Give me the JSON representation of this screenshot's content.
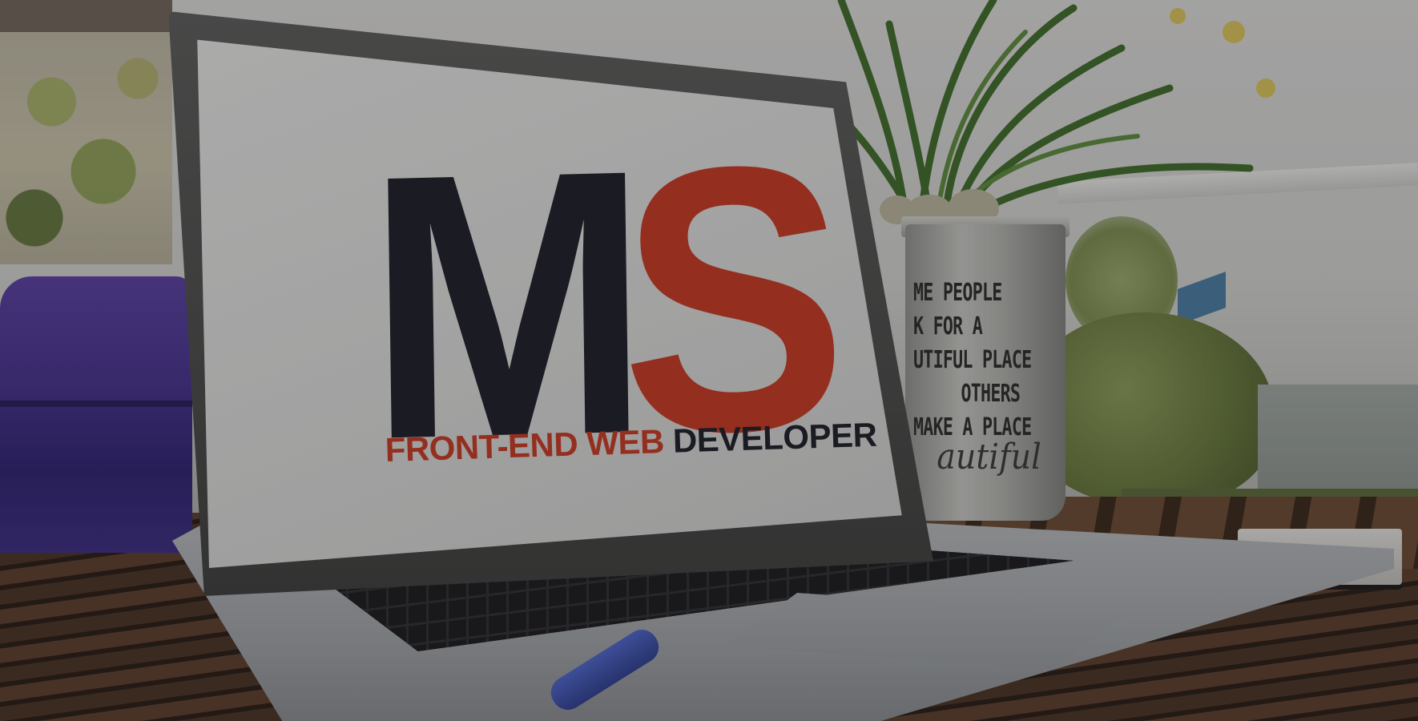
{
  "logo": {
    "letter_m": "M",
    "letter_s": "S",
    "tagline_accent": "FRONT-END WEB",
    "tagline_rest": "DEVELOPER"
  },
  "pot": {
    "lines": [
      "ME PEOPLE",
      "K FOR A",
      "UTIFUL PLACE",
      "OTHERS",
      "MAKE A PLACE"
    ],
    "script": "autiful"
  },
  "colors": {
    "brand_red": "#c53a23",
    "brand_dark": "#1e1e28"
  }
}
